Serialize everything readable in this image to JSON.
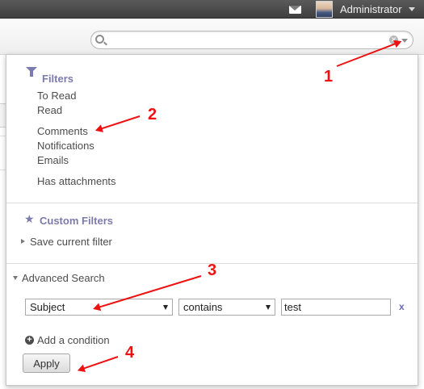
{
  "topbar": {
    "mail_icon": "envelope-icon",
    "user_name": "Administrator"
  },
  "search": {
    "value": "",
    "placeholder": ""
  },
  "filters": {
    "title": "Filters",
    "items": [
      "To Read",
      "Read",
      "Comments",
      "Notifications",
      "Emails",
      "Has attachments"
    ]
  },
  "custom_filters": {
    "title": "Custom Filters",
    "save_label": "Save current filter"
  },
  "advanced_search": {
    "title": "Advanced Search",
    "field_value": "Subject",
    "operator_value": "contains",
    "condition_value": "test",
    "remove_label": "x",
    "add_condition_label": "Add a condition",
    "apply_label": "Apply"
  },
  "annotations": [
    "1",
    "2",
    "3",
    "4"
  ],
  "colors": {
    "accent": "#7c7bad",
    "annotation": "#ee1111",
    "topbar": "#4a4a4a"
  }
}
